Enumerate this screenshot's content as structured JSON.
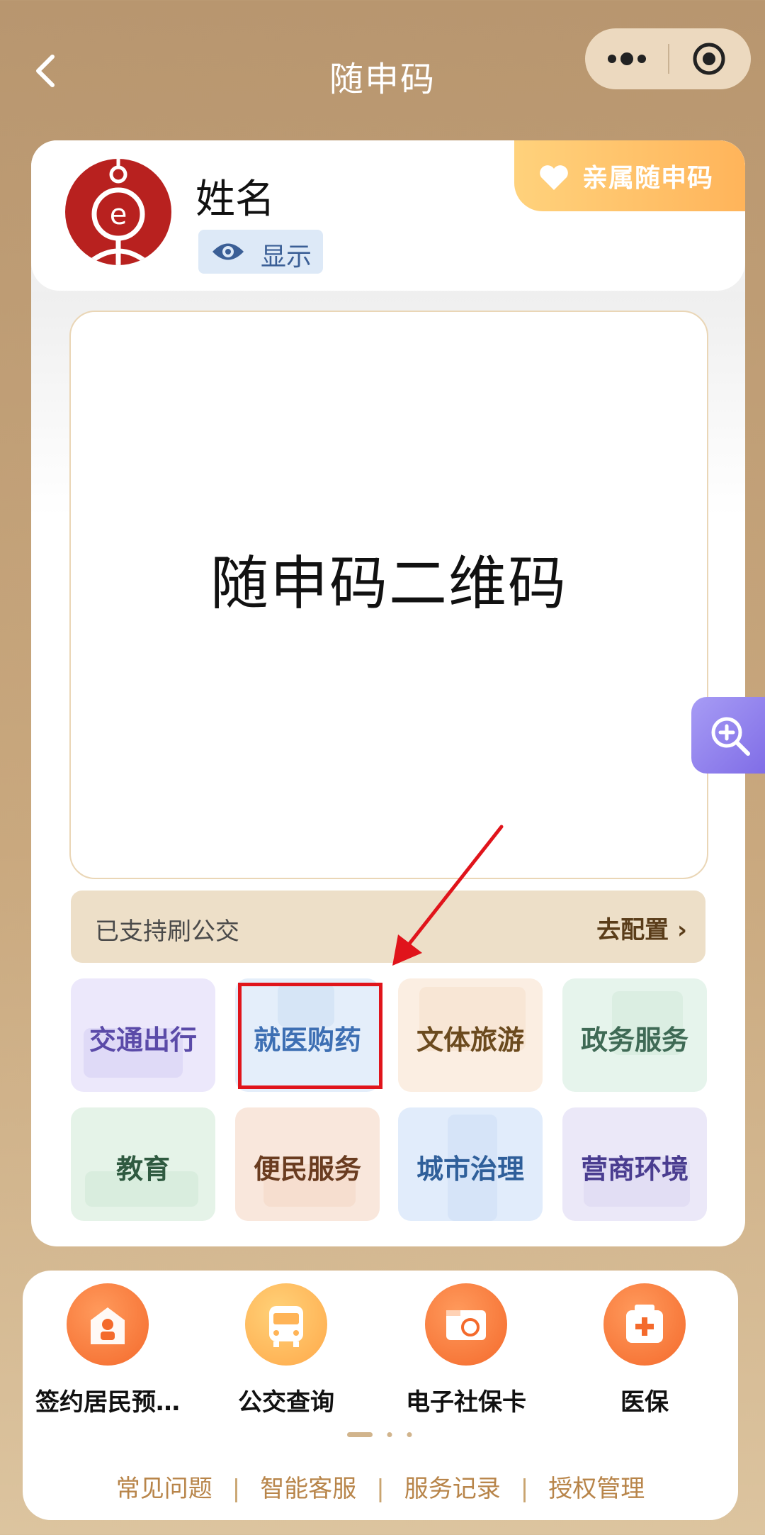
{
  "header": {
    "title": "随申码"
  },
  "user": {
    "name": "姓名",
    "show_label": "显示",
    "family_code_label": "亲属随申码"
  },
  "qr": {
    "placeholder_text": "随申码二维码"
  },
  "bus": {
    "status_text": "已支持刷公交",
    "config_label": "去配置 ›"
  },
  "tiles": [
    {
      "label": "交通出行",
      "color": "#5a4aa8",
      "bg": "#ece8fb"
    },
    {
      "label": "就医购药",
      "color": "#3d6fb3",
      "bg": "#e4eefa"
    },
    {
      "label": "文体旅游",
      "color": "#6b4a1e",
      "bg": "#fbeee2"
    },
    {
      "label": "政务服务",
      "color": "#3f6a55",
      "bg": "#e6f4ec"
    },
    {
      "label": "教育",
      "color": "#2f5a40",
      "bg": "#e5f3e8"
    },
    {
      "label": "便民服务",
      "color": "#6a3c20",
      "bg": "#f9e7dc"
    },
    {
      "label": "城市治理",
      "color": "#2f5f9a",
      "bg": "#e1ecfb"
    },
    {
      "label": "营商环境",
      "color": "#4a3d90",
      "bg": "#ebe8f8"
    }
  ],
  "services": [
    {
      "label": "签约居民预…",
      "icon": "doctor-house-icon"
    },
    {
      "label": "公交查询",
      "icon": "bus-icon"
    },
    {
      "label": "电子社保卡",
      "icon": "social-card-icon"
    },
    {
      "label": "医保",
      "icon": "medical-kit-icon"
    }
  ],
  "links": [
    "常见问题",
    "智能客服",
    "服务记录",
    "授权管理"
  ],
  "colors": {
    "accent_orange": "#ff7a3d",
    "highlight_red": "#e0141b",
    "zoom_purple": "#8a78ea"
  }
}
